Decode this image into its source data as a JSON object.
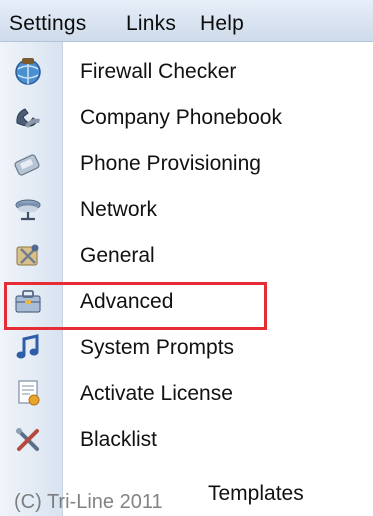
{
  "menubar": {
    "items": [
      "Settings",
      "Links",
      "Help"
    ]
  },
  "menu": {
    "items": [
      {
        "label": "Firewall Checker",
        "icon": "firewall-globe-icon"
      },
      {
        "label": "Company Phonebook",
        "icon": "phonebook-icon"
      },
      {
        "label": "Phone Provisioning",
        "icon": "phone-icon"
      },
      {
        "label": "Network",
        "icon": "network-icon"
      },
      {
        "label": "General",
        "icon": "general-tools-icon"
      },
      {
        "label": "Advanced",
        "icon": "advanced-toolbox-icon"
      },
      {
        "label": "System Prompts",
        "icon": "music-note-icon"
      },
      {
        "label": "Activate License",
        "icon": "license-icon"
      },
      {
        "label": "Blacklist",
        "icon": "blacklist-tools-icon"
      },
      {
        "label": "Templates",
        "icon": "templates-icon"
      }
    ]
  },
  "highlight_color": "#e62d35",
  "watermark": "(C) Tri-Line 2011"
}
